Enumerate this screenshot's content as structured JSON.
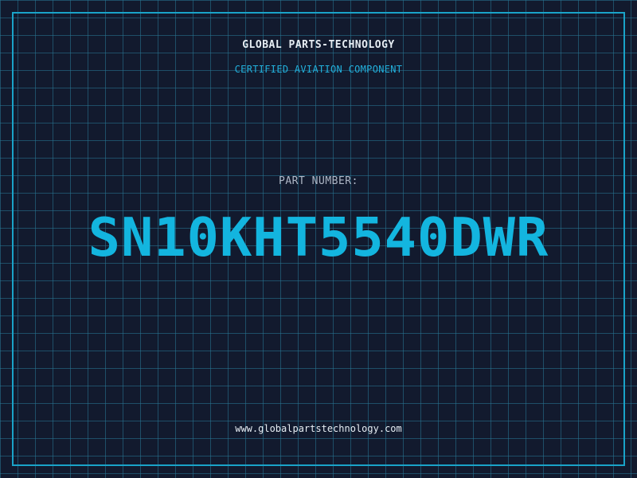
{
  "header": {
    "company": "GLOBAL PARTS-TECHNOLOGY",
    "tagline": "CERTIFIED AVIATION COMPONENT"
  },
  "part": {
    "label": "PART NUMBER:",
    "number": "SN10KHT5540DWR"
  },
  "footer": {
    "website": "www.globalpartstechnology.com"
  },
  "colors": {
    "background": "#121a2e",
    "grid": "#287896",
    "accent": "#13b5df",
    "text": "#e6edf3",
    "muted": "#aeb7c6"
  }
}
